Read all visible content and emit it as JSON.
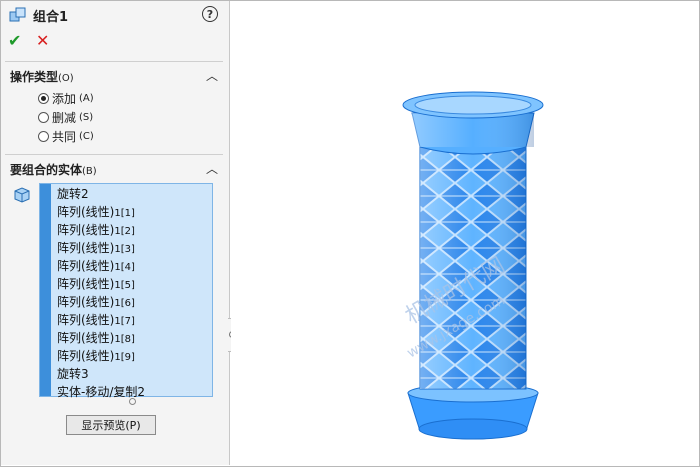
{
  "pm": {
    "title": "组合1",
    "help": "?",
    "ok": "✔",
    "cancel": "✕"
  },
  "operation": {
    "header": "操作类型",
    "header_key": "(O)",
    "options": [
      {
        "label": "添加",
        "key": "(A)",
        "selected": true
      },
      {
        "label": "删减",
        "key": "(S)",
        "selected": false
      },
      {
        "label": "共同",
        "key": "(C)",
        "selected": false
      }
    ]
  },
  "bodies": {
    "header": "要组合的实体",
    "header_key": "(B)",
    "items": [
      {
        "main": "旋转2",
        "idx": ""
      },
      {
        "main": "阵列(线性)",
        "idx": "1[1]"
      },
      {
        "main": "阵列(线性)",
        "idx": "1[2]"
      },
      {
        "main": "阵列(线性)",
        "idx": "1[3]"
      },
      {
        "main": "阵列(线性)",
        "idx": "1[4]"
      },
      {
        "main": "阵列(线性)",
        "idx": "1[5]"
      },
      {
        "main": "阵列(线性)",
        "idx": "1[6]"
      },
      {
        "main": "阵列(线性)",
        "idx": "1[7]"
      },
      {
        "main": "阵列(线性)",
        "idx": "1[8]"
      },
      {
        "main": "阵列(线性)",
        "idx": "1[9]"
      },
      {
        "main": "旋转3",
        "idx": ""
      },
      {
        "main": "实体-移动/复制2",
        "idx": ""
      }
    ]
  },
  "preview": {
    "label": "显示预览",
    "key": "(P)"
  },
  "watermark": {
    "cn": "机械时代网",
    "url": "www.jxage.com"
  },
  "colors": {
    "model": "#4aa8ff",
    "model_dark": "#1e7be0",
    "list_bg": "#cfe6fa",
    "list_bar": "#3d8fdb"
  }
}
